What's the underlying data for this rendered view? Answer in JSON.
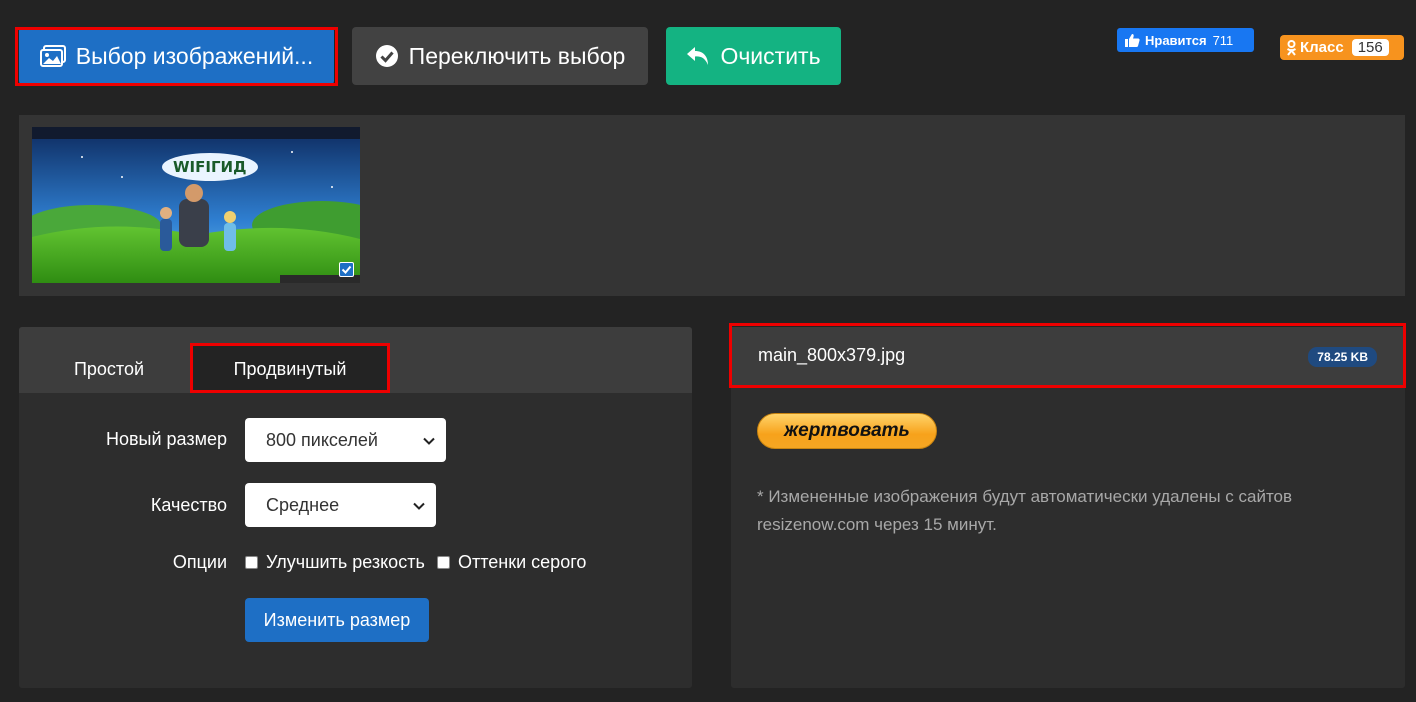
{
  "toolbar": {
    "choose_label": "Выбор изображений...",
    "toggle_label": "Переключить выбор",
    "clear_label": "Очистить"
  },
  "social": {
    "fb_label": "Нравится",
    "fb_count": "711",
    "ok_label": "Класс",
    "ok_count": "156"
  },
  "gallery": {
    "thumb_logo": "WIFIГИД",
    "thumb_selected": true
  },
  "tabs": [
    "Простой",
    "Продвинутый"
  ],
  "form": {
    "size_label": "Новый размер",
    "size_value": "800 пикселей",
    "quality_label": "Качество",
    "quality_value": "Среднее",
    "options_label": "Опции",
    "option_sharpen": "Улучшить резкость",
    "option_grayscale": "Оттенки серого",
    "submit_label": "Изменить размер"
  },
  "result": {
    "filename": "main_800x379.jpg",
    "filesize": "78.25 KB",
    "donate_label": "жертвовать",
    "note": "* Измененные изображения будут автоматически удалены с сайтов resizenow.com через 15 минут."
  },
  "colors": {
    "background": "#232323",
    "primary": "#1e6fc5",
    "success": "#14b382",
    "highlight": "#e00000"
  }
}
